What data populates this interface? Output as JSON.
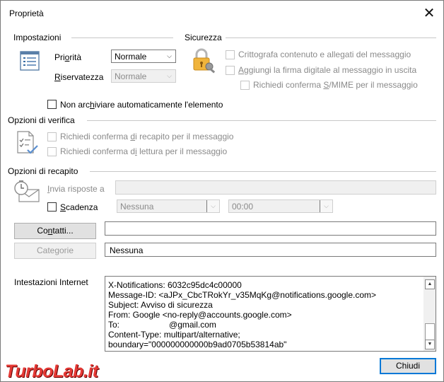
{
  "window": {
    "title": "Proprietà",
    "close_glyph": "✕"
  },
  "settings": {
    "section": "Impostazioni",
    "priority_label_pre": "Pri",
    "priority_label_u": "o",
    "priority_label_post": "rità",
    "priority_value": "Normale",
    "confidentiality_label_u": "R",
    "confidentiality_label_post": "iservatezza",
    "confidentiality_value": "Normale",
    "archive_pre": "Non arc",
    "archive_u": "h",
    "archive_post": "iviare automaticamente l'elemento"
  },
  "security": {
    "section": "Sicurezza",
    "encrypt_pre": "Critto",
    "encrypt_u": "g",
    "encrypt_post": "rafa contenuto e allegati del messaggio",
    "sign_u": "A",
    "sign_post": "ggiungi la firma digitale al messaggio in uscita",
    "smime_pre": "Richiedi conferma ",
    "smime_u": "S",
    "smime_post": "/MIME per il messaggio"
  },
  "verification": {
    "section": "Opzioni di verifica",
    "delivery_pre": "Richiedi conferma ",
    "delivery_u": "d",
    "delivery_post": "i recapito per il messaggio",
    "read_pre": "Richiedi conferma d",
    "read_u": "i",
    "read_post": " lettura per il messaggio"
  },
  "delivery": {
    "section": "Opzioni di recapito",
    "reply_u": "I",
    "reply_post": "nvia risposte a",
    "reply_value": "",
    "expiry_u": "S",
    "expiry_post": "cadenza",
    "expiry_date": "Nessuna",
    "expiry_time": "00:00"
  },
  "contacts": {
    "label_pre": "Co",
    "label_u": "n",
    "label_post": "tatti...",
    "value": ""
  },
  "categories": {
    "label": "Categorie",
    "value": "Nessuna"
  },
  "internet_headers": {
    "label": "Intestazioni Internet",
    "lines": [
      "X-Notifications: 6032c95dc4c00000",
      "Message-ID: <aJPx_CbcTRokYr_v35MqKg@notifications.google.com>",
      "Subject: Avviso di sicurezza",
      "From: Google <no-reply@accounts.google.com>",
      "To:                     @gmail.com",
      "Content-Type: multipart/alternative;",
      "boundary=\"000000000000b9ad0705b53814ab\""
    ]
  },
  "close_button": "Chiudi",
  "watermark": {
    "part1": "TurboLab",
    "part2": ".it"
  },
  "icons": [
    "properties-list-icon",
    "padlock-key-icon",
    "checklist-icon",
    "clock-envelope-icon"
  ]
}
